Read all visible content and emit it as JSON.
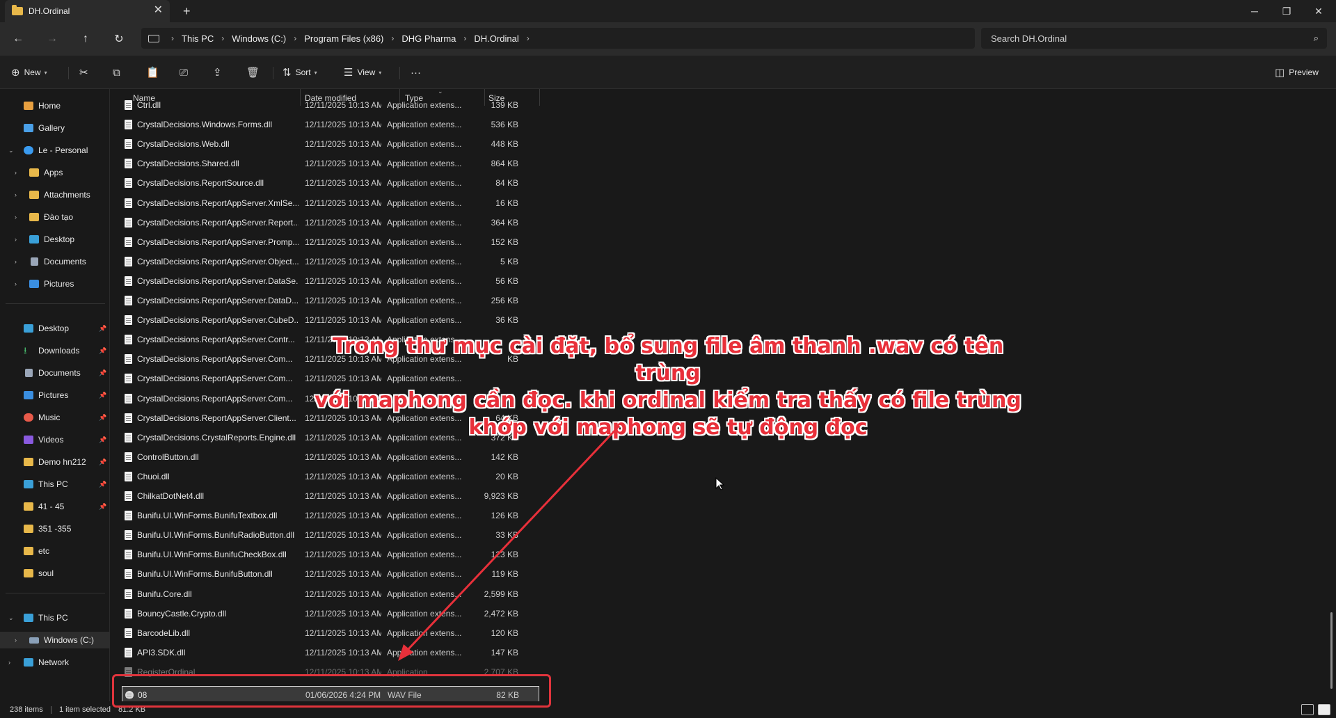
{
  "window": {
    "tab_title": "DH.Ordinal",
    "tab_close": "✕",
    "new_tab": "+",
    "minimize": "─",
    "maximize": "❐",
    "close": "✕"
  },
  "nav": {
    "back": "←",
    "forward": "→",
    "up": "↑",
    "refresh": "↻",
    "breadcrumb": [
      "This PC",
      "Windows (C:)",
      "Program Files (x86)",
      "DHG Pharma",
      "DH.Ordinal"
    ],
    "search_placeholder": "Search DH.Ordinal"
  },
  "toolbar": {
    "new_label": "New",
    "sort_label": "Sort",
    "view_label": "View",
    "more": "···",
    "preview_label": "Preview"
  },
  "sidebar": {
    "top": [
      {
        "label": "Home",
        "icon": "home-icon",
        "color": "#e8a040"
      },
      {
        "label": "Gallery",
        "icon": "gallery-icon",
        "color": "#4aa0e8"
      },
      {
        "label": "Le - Personal",
        "icon": "cloud-icon",
        "color": "#3a9bf0"
      }
    ],
    "onedrive_children": [
      {
        "label": "Apps",
        "icon": "folder-icon"
      },
      {
        "label": "Attachments",
        "icon": "folder-icon"
      },
      {
        "label": "Đào tạo",
        "icon": "folder-icon"
      },
      {
        "label": "Desktop",
        "icon": "desktop-icon"
      },
      {
        "label": "Documents",
        "icon": "documents-icon"
      },
      {
        "label": "Pictures",
        "icon": "pictures-icon"
      }
    ],
    "quick_access": [
      {
        "label": "Desktop",
        "icon": "desktop-icon"
      },
      {
        "label": "Downloads",
        "icon": "download-icon"
      },
      {
        "label": "Documents",
        "icon": "documents-icon"
      },
      {
        "label": "Pictures",
        "icon": "pictures-icon"
      },
      {
        "label": "Music",
        "icon": "music-icon"
      },
      {
        "label": "Videos",
        "icon": "videos-icon"
      },
      {
        "label": "Demo hn212",
        "icon": "folder-icon"
      },
      {
        "label": "This PC",
        "icon": "pc-icon"
      },
      {
        "label": "41 - 45",
        "icon": "folder-icon"
      },
      {
        "label": "351 -355",
        "icon": "folder-icon"
      },
      {
        "label": "etc",
        "icon": "folder-icon"
      },
      {
        "label": "soul",
        "icon": "folder-icon"
      }
    ],
    "bottom": [
      {
        "label": "This PC",
        "icon": "pc-icon"
      },
      {
        "label": "Windows (C:)",
        "icon": "drive-icon"
      },
      {
        "label": "Network",
        "icon": "network-icon"
      }
    ]
  },
  "columns": {
    "name": "Name",
    "date": "Date modified",
    "type": "Type",
    "size": "Size"
  },
  "files": [
    {
      "name": "Ctrl.dll",
      "date": "12/11/2025 10:13 AM",
      "type": "Application extens...",
      "size": "139 KB"
    },
    {
      "name": "CrystalDecisions.Windows.Forms.dll",
      "date": "12/11/2025 10:13 AM",
      "type": "Application extens...",
      "size": "536 KB"
    },
    {
      "name": "CrystalDecisions.Web.dll",
      "date": "12/11/2025 10:13 AM",
      "type": "Application extens...",
      "size": "448 KB"
    },
    {
      "name": "CrystalDecisions.Shared.dll",
      "date": "12/11/2025 10:13 AM",
      "type": "Application extens...",
      "size": "864 KB"
    },
    {
      "name": "CrystalDecisions.ReportSource.dll",
      "date": "12/11/2025 10:13 AM",
      "type": "Application extens...",
      "size": "84 KB"
    },
    {
      "name": "CrystalDecisions.ReportAppServer.XmlSe...",
      "date": "12/11/2025 10:13 AM",
      "type": "Application extens...",
      "size": "16 KB"
    },
    {
      "name": "CrystalDecisions.ReportAppServer.Report...",
      "date": "12/11/2025 10:13 AM",
      "type": "Application extens...",
      "size": "364 KB"
    },
    {
      "name": "CrystalDecisions.ReportAppServer.Promp...",
      "date": "12/11/2025 10:13 AM",
      "type": "Application extens...",
      "size": "152 KB"
    },
    {
      "name": "CrystalDecisions.ReportAppServer.Object...",
      "date": "12/11/2025 10:13 AM",
      "type": "Application extens...",
      "size": "5 KB"
    },
    {
      "name": "CrystalDecisions.ReportAppServer.DataSe...",
      "date": "12/11/2025 10:13 AM",
      "type": "Application extens...",
      "size": "56 KB"
    },
    {
      "name": "CrystalDecisions.ReportAppServer.DataD...",
      "date": "12/11/2025 10:13 AM",
      "type": "Application extens...",
      "size": "256 KB"
    },
    {
      "name": "CrystalDecisions.ReportAppServer.CubeD...",
      "date": "12/11/2025 10:13 AM",
      "type": "Application extens...",
      "size": "36 KB"
    },
    {
      "name": "CrystalDecisions.ReportAppServer.Contr...",
      "date": "12/11/2025 10:13 AM",
      "type": "Application extens...",
      "size": ""
    },
    {
      "name": "CrystalDecisions.ReportAppServer.Com...",
      "date": "12/11/2025 10:13 AM",
      "type": "Application extens...",
      "size": "KB"
    },
    {
      "name": "CrystalDecisions.ReportAppServer.Com...",
      "date": "12/11/2025 10:13 AM",
      "type": "Application extens...",
      "size": ""
    },
    {
      "name": "CrystalDecisions.ReportAppServer.Com...",
      "date": "12/11/2025 10:13 AM",
      "type": "Application extens...",
      "size": ""
    },
    {
      "name": "CrystalDecisions.ReportAppServer.Client...",
      "date": "12/11/2025 10:13 AM",
      "type": "Application extens...",
      "size": "64 KB"
    },
    {
      "name": "CrystalDecisions.CrystalReports.Engine.dll",
      "date": "12/11/2025 10:13 AM",
      "type": "Application extens...",
      "size": "372 KB"
    },
    {
      "name": "ControlButton.dll",
      "date": "12/11/2025 10:13 AM",
      "type": "Application extens...",
      "size": "142 KB"
    },
    {
      "name": "Chuoi.dll",
      "date": "12/11/2025 10:13 AM",
      "type": "Application extens...",
      "size": "20 KB"
    },
    {
      "name": "ChilkatDotNet4.dll",
      "date": "12/11/2025 10:13 AM",
      "type": "Application extens...",
      "size": "9,923 KB"
    },
    {
      "name": "Bunifu.UI.WinForms.BunifuTextbox.dll",
      "date": "12/11/2025 10:13 AM",
      "type": "Application extens...",
      "size": "126 KB"
    },
    {
      "name": "Bunifu.UI.WinForms.BunifuRadioButton.dll",
      "date": "12/11/2025 10:13 AM",
      "type": "Application extens...",
      "size": "33 KB"
    },
    {
      "name": "Bunifu.UI.WinForms.BunifuCheckBox.dll",
      "date": "12/11/2025 10:13 AM",
      "type": "Application extens...",
      "size": "123 KB"
    },
    {
      "name": "Bunifu.UI.WinForms.BunifuButton.dll",
      "date": "12/11/2025 10:13 AM",
      "type": "Application extens...",
      "size": "119 KB"
    },
    {
      "name": "Bunifu.Core.dll",
      "date": "12/11/2025 10:13 AM",
      "type": "Application extens...",
      "size": "2,599 KB"
    },
    {
      "name": "BouncyCastle.Crypto.dll",
      "date": "12/11/2025 10:13 AM",
      "type": "Application extens...",
      "size": "2,472 KB"
    },
    {
      "name": "BarcodeLib.dll",
      "date": "12/11/2025 10:13 AM",
      "type": "Application extens...",
      "size": "120 KB"
    },
    {
      "name": "API3.SDK.dll",
      "date": "12/11/2025 10:13 AM",
      "type": "Application extens...",
      "size": "147 KB"
    },
    {
      "name": "RegisterOrdinal",
      "date": "12/11/2025 10:13 AM",
      "type": "Application",
      "size": "2,707 KB"
    }
  ],
  "selected_file": {
    "name": "08",
    "date": "01/06/2026 4:24 PM",
    "type": "WAV File",
    "size": "82 KB"
  },
  "status": {
    "items": "238 items",
    "selected": "1 item selected",
    "selected_size": "81.2 KB"
  },
  "annotation": {
    "lines": [
      "Trong thư mục cài đặt, bổ sung file âm thanh .wav có tên trùng",
      "với maphong cần đọc. khi ordinal kiểm tra thấy có file trùng",
      "khớp với maphong sẽ tự động đọc"
    ],
    "color": "#e8303a"
  }
}
